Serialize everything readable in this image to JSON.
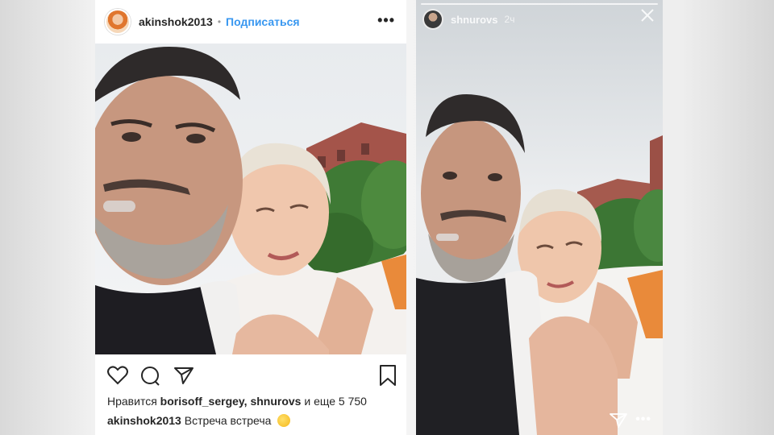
{
  "post": {
    "username": "akinshok2013",
    "separator": "•",
    "follow_label": "Подписаться",
    "more_label": "•••",
    "likes": {
      "prefix": "Нравится",
      "users": "borisoff_sergey, shnurovs",
      "suffix": "и еще 5 750"
    },
    "caption": {
      "username": "akinshok2013",
      "text": "Встреча встреча"
    },
    "icons": [
      "heart-icon",
      "comment-icon",
      "share-icon",
      "bookmark-icon",
      "smiley-emoji-icon"
    ]
  },
  "story": {
    "username": "shnurovs",
    "time": "2ч",
    "more_label": "•••",
    "icons": [
      "close-icon",
      "send-icon"
    ]
  }
}
